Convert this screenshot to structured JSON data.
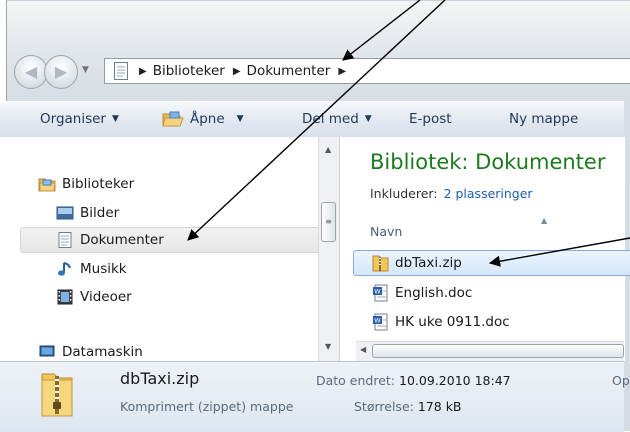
{
  "address_bar": {
    "crumbs": [
      "Biblioteker",
      "Dokumenter"
    ]
  },
  "toolbar": {
    "organise": "Organiser",
    "open": "Åpne",
    "share": "Del med",
    "email": "E-post",
    "new_folder": "Ny mappe"
  },
  "nav_pane": {
    "libraries": "Biblioteker",
    "pictures": "Bilder",
    "documents": "Dokumenter",
    "music": "Musikk",
    "videos": "Videoer",
    "computer": "Datamaskin"
  },
  "content": {
    "title": "Bibliotek: Dokumenter",
    "includes_label": "Inkluderer:",
    "includes_link": "2 plasseringer",
    "column_name": "Navn",
    "files": [
      {
        "name": "dbTaxi.zip",
        "type": "zip"
      },
      {
        "name": "English.doc",
        "type": "doc"
      },
      {
        "name": "HK uke 0911.doc",
        "type": "doc"
      }
    ]
  },
  "details": {
    "name": "dbTaxi.zip",
    "type": "Komprimert (zippet) mappe",
    "date_label": "Dato endret:",
    "date_value": "10.09.2010 18:47",
    "size_label": "Størrelse:",
    "size_value": "178 kB",
    "extra": "Op"
  },
  "colors": {
    "library_title": "#1e7a1e",
    "toolbar_text": "#1e395b",
    "selection_border": "#84acdd",
    "annotation_arrows": "#000000"
  }
}
